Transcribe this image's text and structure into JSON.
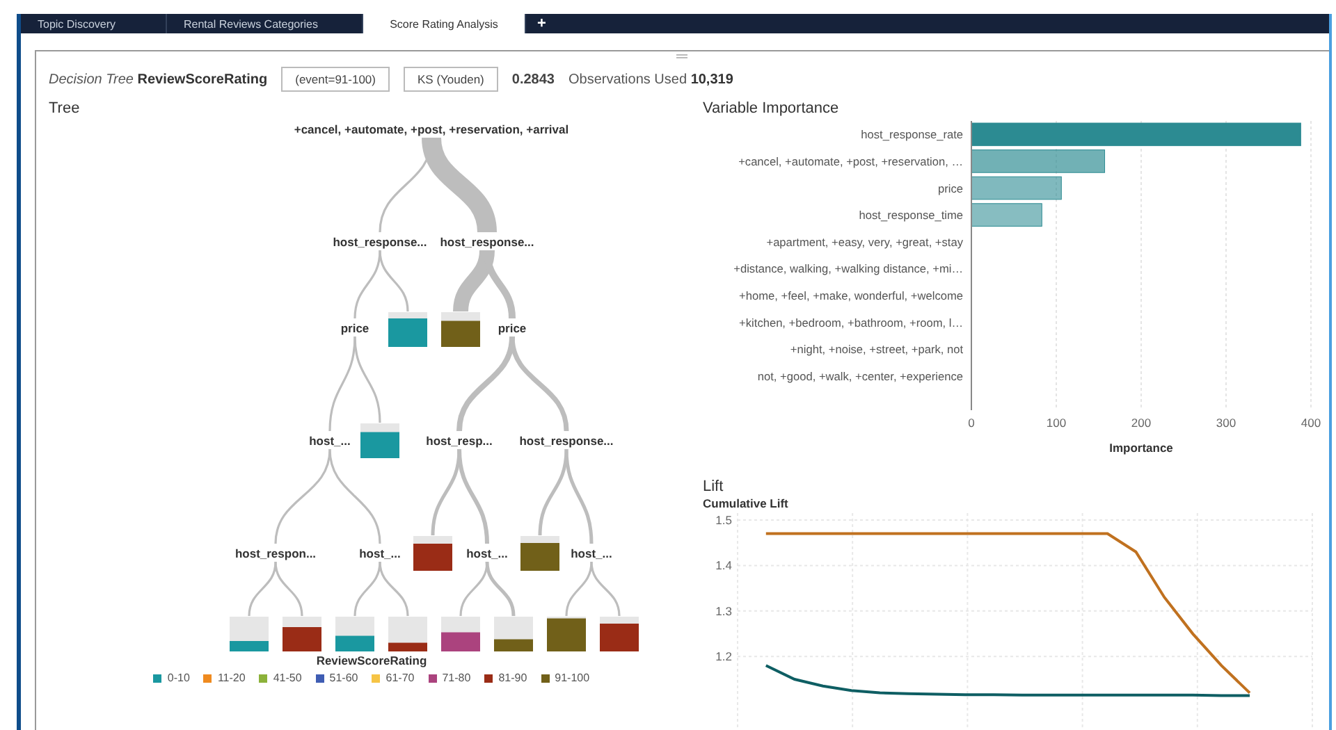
{
  "tabs": [
    {
      "label": "Topic Discovery",
      "selected": false
    },
    {
      "label": "Rental Reviews Categories",
      "selected": false
    },
    {
      "label": "Score Rating Analysis",
      "selected": true
    }
  ],
  "add_tab": "+",
  "header": {
    "title": "*Decision Tree* **ReviewScoreRating**",
    "event_button": "(event=91-100)",
    "statistic_button": "KS (Youden)",
    "statistic_value": "0.2843",
    "observations": "Observations Used **10,319**"
  },
  "tree": {
    "title": "Tree",
    "root": {
      "kind": "split",
      "label": "+cancel, +automate, +post, +reservation, +arrival",
      "children": [
        {
          "kind": "split",
          "label": "host_response...",
          "children": [
            {
              "kind": "split",
              "label": "price",
              "children": [
                {
                  "kind": "split",
                  "label": "host_...",
                  "children": [
                    {
                      "kind": "split",
                      "label": "host_respon...",
                      "children": [
                        {
                          "kind": "leaf",
                          "color": "#1a98a0"
                        },
                        {
                          "kind": "leaf",
                          "color": "#9a2c16"
                        }
                      ]
                    },
                    {
                      "kind": "split",
                      "label": "host_...",
                      "children": [
                        {
                          "kind": "leaf",
                          "color": "#1a98a0"
                        },
                        {
                          "kind": "leaf",
                          "color": "#9a2c16"
                        }
                      ]
                    }
                  ]
                },
                {
                  "kind": "leaf",
                  "color": "#1a98a0"
                }
              ]
            },
            {
              "kind": "leaf",
              "color": "#1a98a0"
            }
          ]
        },
        {
          "kind": "split",
          "label": "host_response...",
          "children": [
            {
              "kind": "leaf",
              "color": "#716019"
            },
            {
              "kind": "split",
              "label": "price",
              "children": [
                {
                  "kind": "split",
                  "label": "host_resp...",
                  "children": [
                    {
                      "kind": "leaf",
                      "color": "#9a2c16"
                    },
                    {
                      "kind": "split",
                      "label": "host_...",
                      "children": [
                        {
                          "kind": "leaf",
                          "color": "#ab437e"
                        },
                        {
                          "kind": "leaf",
                          "color": "#716019"
                        }
                      ]
                    }
                  ]
                },
                {
                  "kind": "split",
                  "label": "host_response...",
                  "children": [
                    {
                      "kind": "leaf",
                      "color": "#716019"
                    },
                    {
                      "kind": "split",
                      "label": "host_...",
                      "children": [
                        {
                          "kind": "leaf",
                          "color": "#716019"
                        },
                        {
                          "kind": "leaf",
                          "color": "#9a2c16"
                        }
                      ]
                    }
                  ]
                }
              ]
            }
          ]
        }
      ]
    },
    "legend": {
      "title": "ReviewScoreRating",
      "items": [
        {
          "label": "0-10",
          "color": "#1a98a0"
        },
        {
          "label": "11-20",
          "color": "#ef8a1f"
        },
        {
          "label": "41-50",
          "color": "#8cb23a"
        },
        {
          "label": "51-60",
          "color": "#3f5db3"
        },
        {
          "label": "61-70",
          "color": "#f6c445"
        },
        {
          "label": "71-80",
          "color": "#ab437e"
        },
        {
          "label": "81-90",
          "color": "#9a2c16"
        },
        {
          "label": "91-100",
          "color": "#716019"
        }
      ]
    }
  },
  "variable_importance": {
    "title": "Variable Importance",
    "chart_data": {
      "type": "bar",
      "orientation": "horizontal",
      "xlabel": "Importance",
      "categories": [
        "host_response_rate",
        "+cancel, +automate, +post, +reservation, …",
        "price",
        "host_response_time",
        "+apartment, +easy, very, +great, +stay",
        "+distance, walking, +walking distance, +mi…",
        "+home, +feel, +make, wonderful, +welcome",
        "+kitchen, +bedroom, +bathroom, +room, l…",
        "+night, +noise, +street, +park, not",
        "not, +good, +walk, +center, +experience"
      ],
      "series": [
        {
          "color": "#2c8b92",
          "values": [
            388,
            157,
            106,
            83,
            0,
            0,
            0,
            0,
            0,
            0
          ]
        }
      ],
      "xlim": [
        0,
        400
      ],
      "xticks": [
        0,
        100,
        200,
        300,
        400
      ],
      "grid": true
    }
  },
  "lift": {
    "title": "Lift",
    "chart_data": {
      "type": "line",
      "ylabel": "Cumulative Lift",
      "categories": [
        null,
        null,
        null,
        null,
        null,
        null,
        null,
        null,
        null,
        null,
        null,
        null,
        null,
        null,
        null,
        null,
        null,
        null
      ],
      "series": [
        {
          "color": "#c0711f",
          "values": [
            1.47,
            1.47,
            1.47,
            1.47,
            1.47,
            1.47,
            1.47,
            1.47,
            1.47,
            1.47,
            1.47,
            1.47,
            1.47,
            1.43,
            1.33,
            1.25,
            1.18,
            1.12
          ]
        },
        {
          "color": "#0e5e63",
          "values": [
            1.18,
            1.15,
            1.135,
            1.125,
            1.12,
            1.118,
            1.117,
            1.116,
            1.116,
            1.115,
            1.115,
            1.115,
            1.115,
            1.115,
            1.115,
            1.115,
            1.114,
            1.114
          ]
        }
      ],
      "ylim": [
        1.0,
        1.5
      ],
      "yticks": [
        1.2,
        1.3,
        1.4,
        1.5
      ],
      "grid": true
    }
  }
}
